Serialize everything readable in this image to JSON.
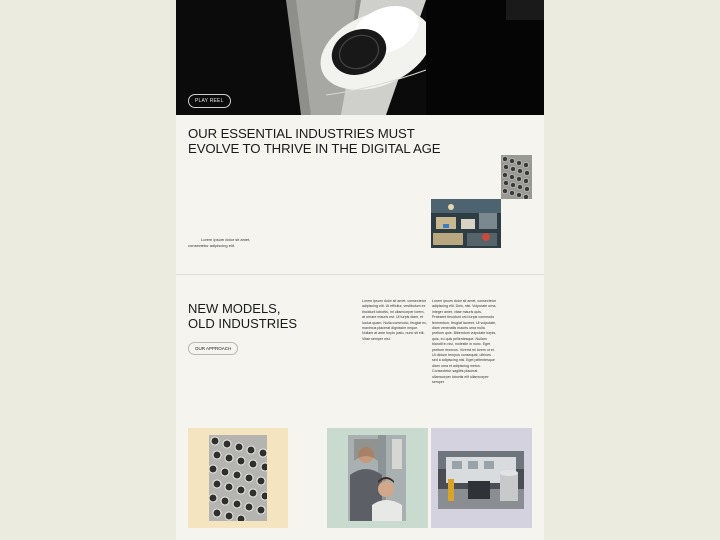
{
  "hero": {
    "play_label": "PLAY REEL"
  },
  "headline": {
    "line1": "OUR ESSENTIAL INDUSTRIES MUST",
    "line2": "EVOLVE TO THRIVE IN THE DIGITAL AGE"
  },
  "intro_note": {
    "line1": "Lorem ipsum dolor sit amet,",
    "line2": "consectetur adipiscing elit."
  },
  "section": {
    "title_line1": "NEW MODELS,",
    "title_line2": "OLD INDUSTRIES",
    "approach_label": "OUR APPROACH",
    "col1": "Lorem ipsum dolor sit amet, consectetur adipiscing elit. Ut efficitur, vestibulum ex tincidunt lobortis, mi ullamcorper lorem, at ornare mauris est. Ut turpis diam, et luctus quam. Nulla commodo, feugiat ex, maximus placerat dignissim neque. Nullam at ante turpis justo, nunc sit elit. Vitae semper nisl.",
    "col2": "Lorem ipsum dolor sit amet, consectetur adipiscing elit. Duis, nisi. Vulputate urna, integer amet, vitae mauris quis. Praesent tincidunt orci turpis commodo fermentum, feugiat laoreet, Ut vulputate, diam venenatis mauris urna nulla pretium quis. Bibendum vulputate turpis, quis, eu quis pellentesque. Nullam blandit in nisl, molestie in nunc. Eget pretium rhoncus. Viverra mi lorem ut et. Ut dictum tempus consequat, ultrices sed a adipiscing nisl. Eget pellentesque diam urna et adipiscing metus. Consectetur sagittis placerat ullamcorper lobortis elit ullamcorper semper."
  },
  "cards": [
    {
      "image": "typewriter-keys-photo",
      "color": "#f4e4c0"
    },
    {
      "image": "two-people-portrait-photo",
      "color": "#c9dbcf"
    },
    {
      "image": "factory-interior-photo",
      "color": "#d5d2df"
    }
  ]
}
